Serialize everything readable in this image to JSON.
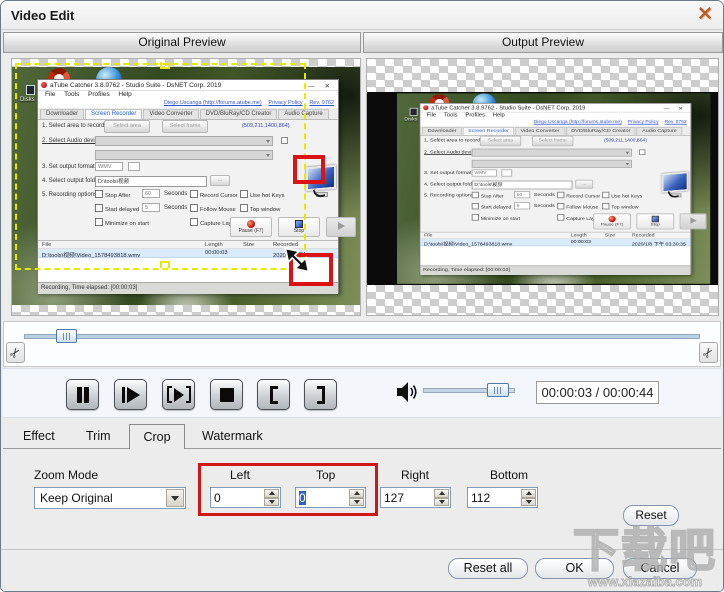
{
  "window": {
    "title": "Video Edit"
  },
  "preview_headers": {
    "original": "Original Preview",
    "output": "Output Preview"
  },
  "inner_app": {
    "title": "aTube Catcher 3.8.9762 - Studio Suite - DsNET Corp. 2019",
    "window_controls": "—  ✕",
    "desktop_label": "Disks",
    "menus": [
      "File",
      "Tools",
      "Profiles",
      "Help"
    ],
    "links": [
      "Diego Uscanga (http://forums.atube.me)",
      "Privacy Policy",
      "Rev. 9762"
    ],
    "tabs": [
      "Downloader",
      "Screen Recorder",
      "Video Converter",
      "DVD/BluRay/CD Creator",
      "Audio Capture"
    ],
    "step1": {
      "label": "1. Select area to record",
      "select_area": "Select area",
      "select_frame": "Select frame",
      "coords": "(509,211,1400,864)"
    },
    "step2": {
      "label": "2. Select Audio device"
    },
    "step3": {
      "label": "3. Set output format",
      "format": "WMV"
    },
    "step4": {
      "label": "4. Select output folder",
      "path": "D:\\tools\\视频",
      "browse": "..."
    },
    "step5": {
      "label": "5. Recording options",
      "col1": [
        "Stop After",
        "Start delayed",
        "Minimize on start"
      ],
      "col1_vals": [
        "60",
        "5"
      ],
      "seconds": "Seconds",
      "col2": [
        "Record Cursor",
        "Follow Mouse",
        "Capture Layered"
      ],
      "col3": [
        "Use hot Keys",
        "Top window"
      ]
    },
    "pause_btn": "Pause (F7)",
    "stop_btn": "Stop",
    "files": {
      "col_file": "File",
      "col_length": "Length",
      "col_size": "Size",
      "col_recorded": "Recorded",
      "row_file": "D:\\tools\\视频\\Video_1578493818.wmv",
      "row_length": "00:00:03",
      "row_recorded": "2020/1/8 下午 03:30:35"
    },
    "status": "Recording, Time elapsed: [00:00:03]"
  },
  "transport": {
    "time": "00:00:03 / 00:00:44"
  },
  "tabs": {
    "effect": "Effect",
    "trim": "Trim",
    "crop": "Crop",
    "watermark": "Watermark"
  },
  "crop": {
    "zoom_mode_label": "Zoom Mode",
    "zoom_mode_value": "Keep Original",
    "fields": [
      {
        "label": "Left",
        "value": "0"
      },
      {
        "label": "Top",
        "value": "0"
      },
      {
        "label": "Right",
        "value": "127"
      },
      {
        "label": "Bottom",
        "value": "112"
      }
    ],
    "reset_label": "Reset"
  },
  "footer": {
    "reset_all": "Reset all",
    "ok": "OK",
    "cancel": "Cancel"
  },
  "watermark": {
    "text": "下载吧",
    "url": "www.xiazaiba.com"
  },
  "colors": {
    "highlight_red": "#d01616",
    "crop_dash_yellow": "#e9e900",
    "accent_blue": "#4d7aa8"
  }
}
